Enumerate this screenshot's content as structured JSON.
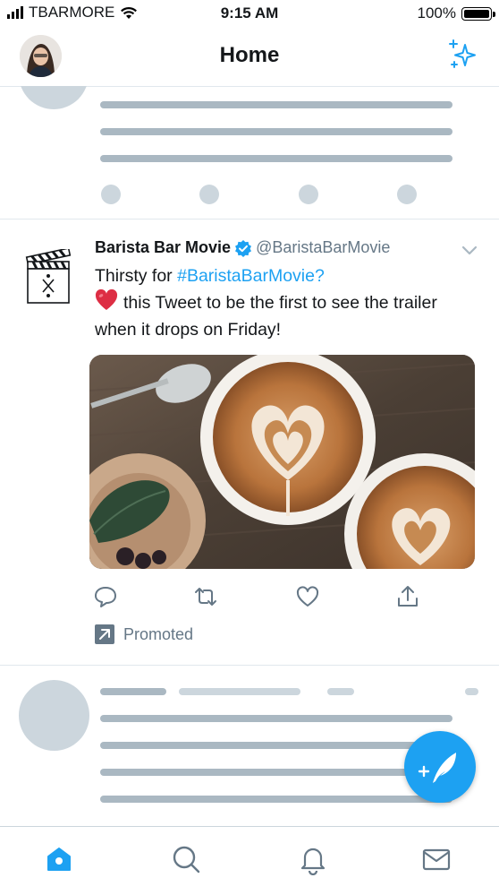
{
  "status_bar": {
    "carrier": "TBARMORE",
    "time": "9:15 AM",
    "battery": "100%"
  },
  "header": {
    "title": "Home",
    "avatar_icon": "user-avatar",
    "sparkle_icon": "sparkle-icon"
  },
  "tweet": {
    "display_name": "Barista Bar Movie",
    "verified": true,
    "handle": "@BaristaBarMovie",
    "text_line1_prefix": "Thirsty for ",
    "hashtag": "#BaristaBarMovie?",
    "text_line2": "this Tweet to be the first to see the trailer when it drops on Friday!",
    "media_description_icon": "latte-photo",
    "promoted_label": "Promoted"
  },
  "actions": [
    {
      "name": "reply",
      "icon": "reply-icon"
    },
    {
      "name": "retweet",
      "icon": "retweet-icon"
    },
    {
      "name": "like",
      "icon": "heart-icon"
    },
    {
      "name": "share",
      "icon": "share-icon"
    }
  ],
  "tabs": [
    {
      "name": "home",
      "icon": "home-icon",
      "active": true
    },
    {
      "name": "search",
      "icon": "search-icon",
      "active": false
    },
    {
      "name": "notifications",
      "icon": "bell-icon",
      "active": false
    },
    {
      "name": "messages",
      "icon": "mail-icon",
      "active": false
    }
  ],
  "colors": {
    "accent": "#1da1f2",
    "placeholder_dark": "#aab8c2",
    "placeholder_light": "#ccd6dd",
    "text_secondary": "#657786"
  }
}
